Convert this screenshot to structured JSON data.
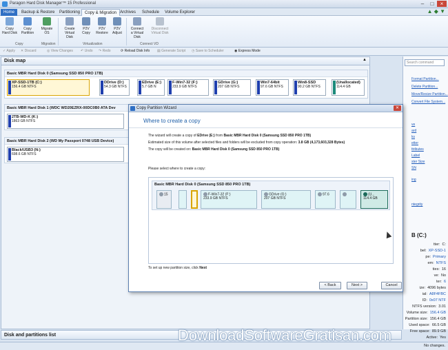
{
  "window": {
    "title": "Paragon Hard Disk Manager™ 15 Professional"
  },
  "menu": [
    {
      "label": "Home"
    },
    {
      "label": "Backup & Restore"
    },
    {
      "label": "Partitioning"
    },
    {
      "label": "Copy & Migration"
    },
    {
      "label": "Archives"
    },
    {
      "label": "Schedule"
    },
    {
      "label": "Volume Explorer"
    }
  ],
  "ribbon": {
    "buttons": [
      {
        "label": "Copy Hard Disk"
      },
      {
        "label": "Copy Partition"
      },
      {
        "label": "Migrate OS"
      },
      {
        "label": "Create Virtual Disk"
      },
      {
        "label": "P2V Copy"
      },
      {
        "label": "P2V Restore"
      },
      {
        "label": "P2V Adjust"
      },
      {
        "label": "Connect a Virtual Disk"
      },
      {
        "label": "Disconnect Virtual Disk"
      }
    ],
    "groups": [
      {
        "label": "Copy"
      },
      {
        "label": "Migration"
      },
      {
        "label": "Virtualization"
      },
      {
        "label": "Connect VD"
      }
    ]
  },
  "toolbar": {
    "apply": "Apply",
    "discard": "Discard",
    "view_changes": "View Changes",
    "undo": "Undo",
    "redo": "Redo",
    "reload": "Reload Disk Info",
    "generate": "Generate Script",
    "save_scheduler": "Save to Scheduler",
    "express": "Express Mode"
  },
  "diskmap": {
    "title": "Disk map",
    "disks": [
      {
        "header": "Basic MBR Hard Disk 0 (Samsung SSD 850 PRO 1TB)",
        "partitions": [
          {
            "name": "XP-SSD-1TB (C:)",
            "info": "156.4 GB NTFS"
          },
          {
            "name": "DDrive (D:)",
            "info": "54.3 GB NTFS"
          },
          {
            "name": "EDrive (E:)",
            "info": "5.7 GB N"
          },
          {
            "name": "F-Win7-32 (F:)",
            "info": "233.9 GB NTFS"
          },
          {
            "name": "GDrive (G:)",
            "info": "207 GB NTFS"
          },
          {
            "name": "Win7-64bit",
            "info": "97.6 GB NTFS"
          },
          {
            "name": "Win8-SSD",
            "info": "90.2 GB NTFS"
          },
          {
            "name": "(Unallocated)",
            "info": "114.4 GB"
          }
        ]
      },
      {
        "header": "Basic MBR Hard Disk 1 (WDC WD20EZRX-00DC0B0 ATA Dev",
        "partitions": [
          {
            "name": "2TB-WD-K (K:)",
            "info": "1863 GB NTFS"
          }
        ]
      },
      {
        "header": "Basic MBR Hard Disk 2 (WD My Passport 0748 USB Device)",
        "partitions": [
          {
            "name": "Black/USB3 (N:)",
            "info": "698.6 GB NTFS"
          }
        ]
      }
    ]
  },
  "rightpanel": {
    "search_placeholder": "Search command",
    "links": [
      "Format Partition...",
      "Delete Partition...",
      "Move/Resize Partition...",
      "Convert File System..."
    ],
    "fragments": [
      "ve",
      "ard",
      "ks",
      "etter",
      "ttributes",
      "Label",
      "ster Size",
      "SN",
      "",
      "ing",
      "",
      "",
      "",
      "ntegrity"
    ],
    "volume_title": "B (C:)",
    "properties": [
      {
        "label": "tter:",
        "value": "C:",
        "link": false
      },
      {
        "label": "bel:",
        "value": "XP-SSD-1",
        "link": true
      },
      {
        "label": "pe:",
        "value": "Primary",
        "link": true
      },
      {
        "label": "em:",
        "value": "NTFS",
        "link": true
      },
      {
        "label": "ties:",
        "value": "16",
        "link": false
      },
      {
        "label": "ve:",
        "value": "No",
        "link": false
      },
      {
        "label": "ter:",
        "value": "6",
        "link": true
      },
      {
        "label": "ize:",
        "value": "4096 bytes",
        "link": false
      },
      {
        "label": "ial:",
        "value": "A8F4FBC",
        "link": true
      },
      {
        "label": "ID:",
        "value": "0x07 NTF",
        "link": true
      },
      {
        "label": "NTFS version:",
        "value": "3.01",
        "link": false
      },
      {
        "label": "Volume size:",
        "value": "156.4 GB",
        "link": true
      },
      {
        "label": "Partition size:",
        "value": "156.4 GB",
        "link": false
      },
      {
        "label": "Used space:",
        "value": "66.5 GB",
        "link": false
      },
      {
        "label": "Free space:",
        "value": "89.9 GB",
        "link": false
      },
      {
        "label": "Active:",
        "value": "Yes",
        "link": false
      },
      {
        "label": "Hidden:",
        "value": "No",
        "link": false
      }
    ]
  },
  "partitions_list": {
    "title": "Disk and partitions list"
  },
  "status": {
    "text": "No changes."
  },
  "watermark": "DownloadSoftwareGratisan.com",
  "wizard": {
    "title": "Copy Partition Wizard",
    "heading": "Where to create a copy",
    "line1_pre": "The wizard will create a copy of ",
    "line1_bold1": "EDrive (E:)",
    "line1_mid": " from ",
    "line1_bold2": "Basic MBR Hard Disk 0 (Samsung SSD 850 PRO 1TB)",
    "line2_pre": "Estimated size of this volume after selected files and folders will be excluded from copy operation: ",
    "line2_bold": "3.8 GB (4,173,603,328 Bytes)",
    "line3_pre": "The copy will be created on: ",
    "line3_bold": "Basic MBR Hard Disk 0 (Samsung SSD 850 PRO 1TB)",
    "select_text": "Please select where to create a copy:",
    "disk_header": "Basic MBR Hard Disk 0 (Samsung SSD 850 PRO 1TB)",
    "partitions": [
      {
        "name": "",
        "info": "15"
      },
      {
        "name": "",
        "info": ""
      },
      {
        "name": "",
        "info": ""
      },
      {
        "name": "F-Win7-32 (F:)",
        "info": "233.9 GB NTFS"
      },
      {
        "name": "GDrive (G:)",
        "info": "207 GB NTFS"
      },
      {
        "name": "",
        "info": "97.6"
      },
      {
        "name": "",
        "info": ""
      },
      {
        "name": "(U...",
        "info": "114.4 GB"
      }
    ],
    "footer_pre": "To set up new partition size, click ",
    "footer_bold": "Next",
    "back": "< Back",
    "next": "Next >",
    "cancel": "Cancel"
  }
}
